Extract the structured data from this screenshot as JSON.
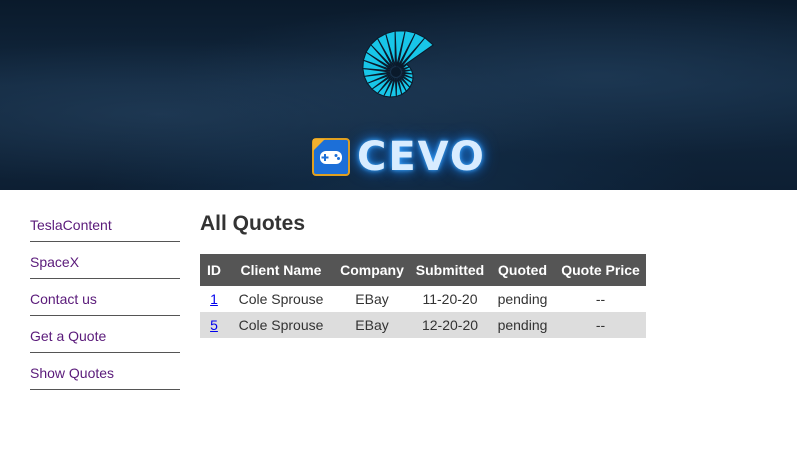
{
  "banner": {
    "brand": "CEVO",
    "shell_color": "#18c6e8",
    "glow_color": "#3fa9ff"
  },
  "sidebar": {
    "items": [
      {
        "label": "TeslaContent"
      },
      {
        "label": "SpaceX"
      },
      {
        "label": "Contact us"
      },
      {
        "label": "Get a Quote"
      },
      {
        "label": "Show Quotes"
      }
    ]
  },
  "main": {
    "title": "All Quotes",
    "table": {
      "headers": [
        "ID",
        "Client Name",
        "Company",
        "Submitted",
        "Quoted",
        "Quote Price"
      ],
      "rows": [
        {
          "id": "1",
          "client": "Cole Sprouse",
          "company": "EBay",
          "submitted": "11-20-20",
          "quoted": "pending",
          "price": "--"
        },
        {
          "id": "5",
          "client": "Cole Sprouse",
          "company": "EBay",
          "submitted": "12-20-20",
          "quoted": "pending",
          "price": "--"
        }
      ]
    }
  }
}
